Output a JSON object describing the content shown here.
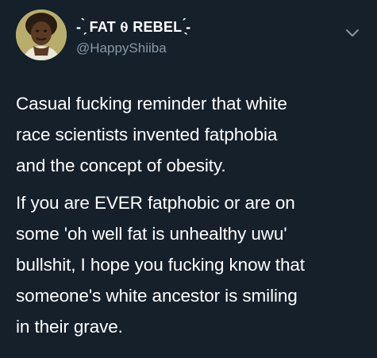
{
  "tweet": {
    "display_name": "- ̗̀ FAT ⍬ REBEL  ̖́-",
    "handle": "@HappyShiiba",
    "paragraphs": [
      {
        "lines": [
          "Casual fucking reminder that white",
          "race scientists invented fatphobia",
          "and the concept of obesity."
        ]
      },
      {
        "lines": [
          "If you are EVER fatphobic or are on",
          "some 'oh well fat is unhealthy uwu'",
          "bullshit, I hope you fucking know that",
          "someone's white ancestor is smiling",
          "in their grave."
        ]
      }
    ]
  },
  "icons": {
    "avatar": "profile-avatar",
    "menu": "chevron-down-icon"
  },
  "colors": {
    "background": "#15202b",
    "text": "#ffffff",
    "secondary": "#8899a6",
    "avatar_bg": "#b9ad6e"
  }
}
